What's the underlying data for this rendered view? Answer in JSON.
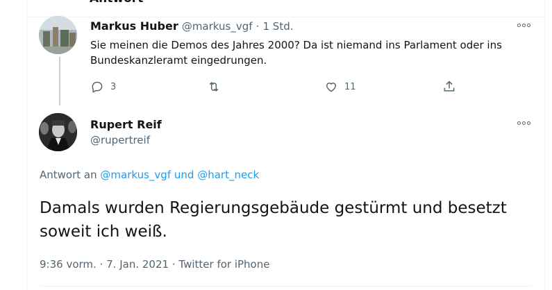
{
  "header_fragment": "Antwort",
  "reply_tweet": {
    "name": "Markus Huber",
    "handle": "@markus_vgf",
    "separator": "·",
    "time": "1 Std.",
    "text": "Sie meinen die Demos des Jahres 2000? Da ist niemand ins Parlament oder ins Bundeskanzleramt eingedrungen.",
    "actions": {
      "reply_count": "3",
      "like_count": "11"
    }
  },
  "main_tweet": {
    "name": "Rupert Reif",
    "handle": "@rupertreif",
    "reply_prefix": "Antwort an",
    "reply_to_1": "@markus_vgf",
    "reply_and": "und",
    "reply_to_2": "@hart_neck",
    "text": "Damals wurden Regierungsgebäude gestürmt und besetzt soweit ich weiß.",
    "time": "9:36 vorm.",
    "date": "7. Jan. 2021",
    "source": "Twitter for iPhone",
    "dot": "·"
  },
  "colors": {
    "link": "#1d9bf0",
    "secondary": "#536471",
    "text": "#0f1419"
  }
}
